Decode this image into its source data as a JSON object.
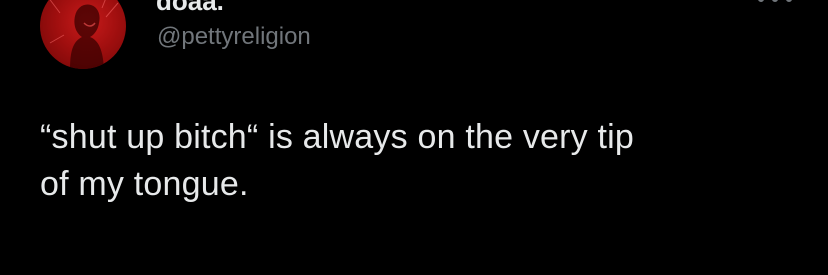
{
  "tweet": {
    "author": {
      "display_name": "doaa.",
      "handle": "@pettyreligion",
      "avatar": "avatar-icon"
    },
    "more_icon": "more-options-icon",
    "text_line_1": "“shut up bitch“ is always on the very tip",
    "text_line_2": "of my tongue."
  },
  "colors": {
    "background": "#000000",
    "primary_text": "#e7e9ea",
    "secondary_text": "#71767b",
    "avatar_red": "#c81b1b"
  }
}
